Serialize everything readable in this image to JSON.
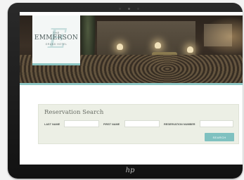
{
  "logo": {
    "top_text": "THE",
    "name": "EMMERSON",
    "subtitle": "GRAND HOTEL",
    "monogram": "E"
  },
  "reservation": {
    "title": "Reservation Search",
    "fields": [
      {
        "label": "LAST NAME",
        "value": ""
      },
      {
        "label": "FIRST NAME",
        "value": ""
      },
      {
        "label": "RESERVATION NUMBER",
        "value": ""
      }
    ],
    "search_label": "SEARCH"
  },
  "device": {
    "brand_mark": "hp"
  },
  "colors": {
    "accent": "#8cc6c4",
    "button": "#7fc1c0",
    "panel": "#ecefe5"
  }
}
